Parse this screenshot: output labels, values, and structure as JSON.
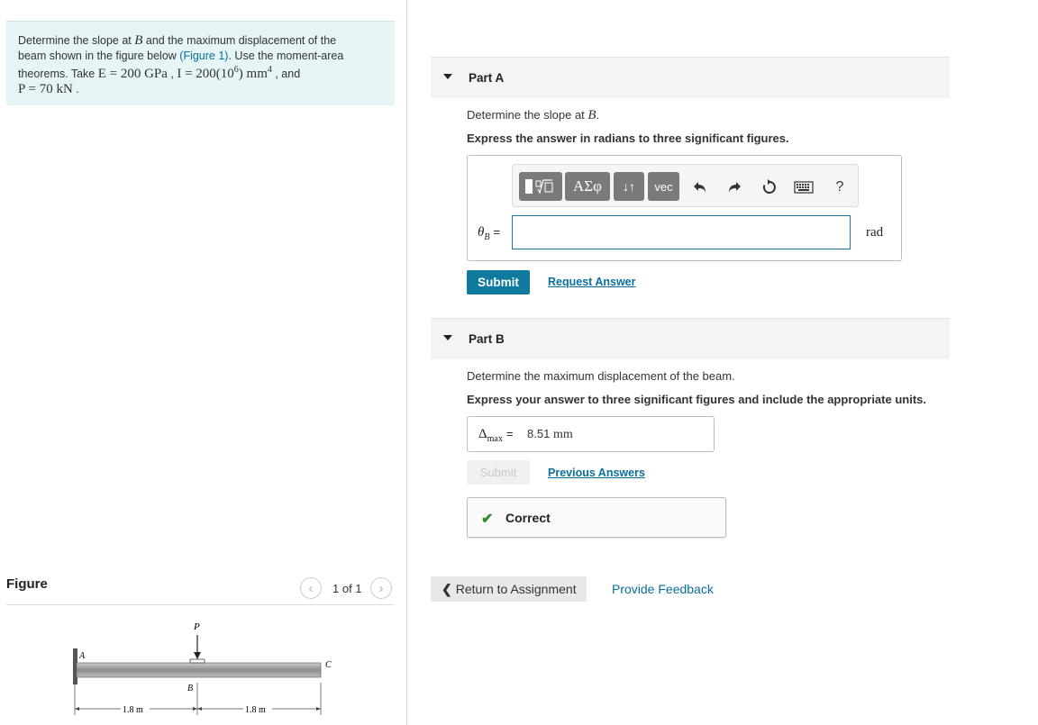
{
  "problem": {
    "line1_a": "Determine the slope at ",
    "line1_var": "B",
    "line1_b": " and the maximum displacement of the",
    "line2_a": "beam shown in the figure below ",
    "line2_link": "(Figure 1)",
    "line2_b": ". Use the moment-area",
    "line3_a": "theorems. Take ",
    "E_expr": "E = 200 GPa",
    "I_expr_a": "I = 200(10",
    "I_exp": "6",
    "I_expr_b": ") mm",
    "I_unit_exp": "4",
    "line3_b": " , and",
    "P_expr": "P = 70 kN",
    "P_after": " ."
  },
  "figure": {
    "label": "Figure",
    "count": "1 of 1",
    "prev_icon": "chevron-left-icon",
    "next_icon": "chevron-right-icon",
    "load_label": "P",
    "label_A": "A",
    "label_B": "B",
    "label_C": "C",
    "dim1": "1.8 m",
    "dim2": "1.8 m"
  },
  "partA": {
    "title": "Part A",
    "question": "Determine the slope at ",
    "question_var": "B",
    "question_end": ".",
    "instruction": "Express the answer in radians to three significant figures.",
    "toolbar": {
      "greek": "ΑΣφ",
      "arrows": "↓↑",
      "vec": "vec",
      "help": "?"
    },
    "var_symbol": "θ",
    "var_sub": "B",
    "equals": "=",
    "input_value": "",
    "unit": "rad",
    "submit_label": "Submit",
    "request_label": "Request Answer"
  },
  "partB": {
    "title": "Part B",
    "question": "Determine the maximum displacement of the beam.",
    "instruction": "Express your answer to three significant figures and include the appropriate units.",
    "var_symbol": "Δ",
    "var_sub": "max",
    "equals": "=",
    "answer_value": "8.51",
    "answer_unit": "mm",
    "submit_label": "Submit",
    "previous_label": "Previous Answers",
    "feedback_text": "Correct",
    "feedback_color": "#2e8b2e"
  },
  "footer": {
    "return_label": "Return to Assignment",
    "feedback_link": "Provide Feedback"
  },
  "colors": {
    "accent": "#0f7a9e",
    "link": "#0a6e9e",
    "problem_bg": "#e6f5f5"
  }
}
